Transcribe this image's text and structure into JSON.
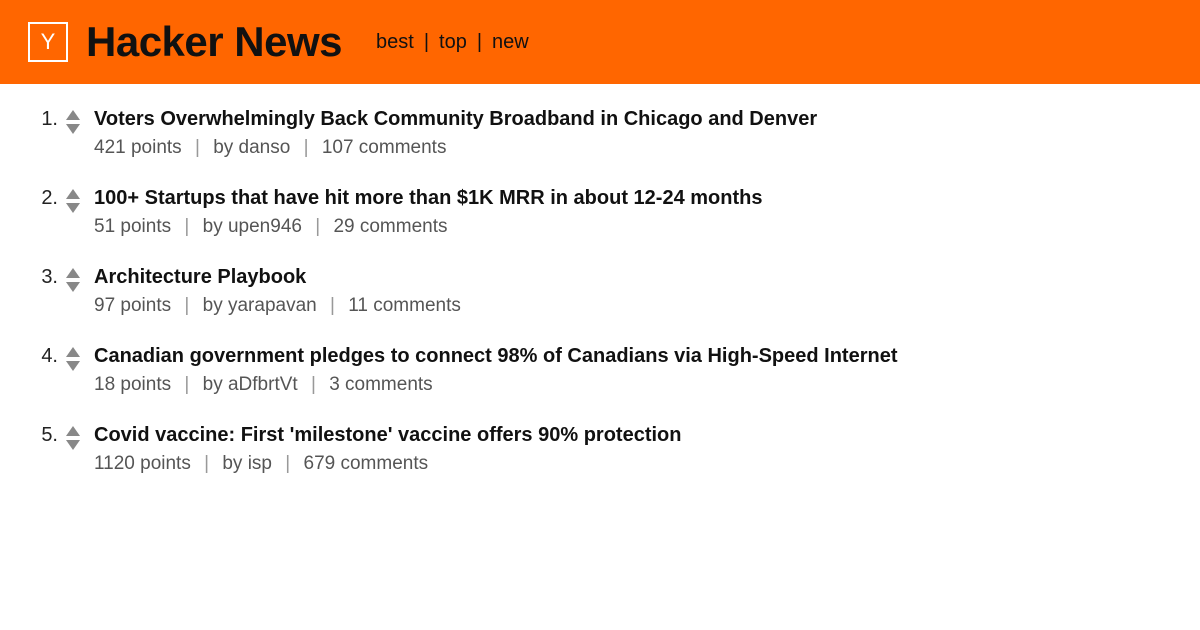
{
  "header": {
    "logo_letter": "Y",
    "title": "Hacker News",
    "nav": [
      "best",
      "top",
      "new"
    ]
  },
  "stories": [
    {
      "rank": "1.",
      "title": "Voters Overwhelmingly Back Community Broadband in Chicago and Denver",
      "points": "421 points",
      "by_prefix": "by ",
      "author": "danso",
      "comments": "107 comments"
    },
    {
      "rank": "2.",
      "title": "100+ Startups that have hit more than $1K MRR in about 12-24 months",
      "points": "51 points",
      "by_prefix": "by ",
      "author": "upen946",
      "comments": "29 comments"
    },
    {
      "rank": "3.",
      "title": "Architecture Playbook",
      "points": "97 points",
      "by_prefix": "by ",
      "author": "yarapavan",
      "comments": "11 comments"
    },
    {
      "rank": "4.",
      "title": "Canadian government pledges to connect 98% of Canadians via High-Speed Internet",
      "points": "18 points",
      "by_prefix": "by ",
      "author": "aDfbrtVt",
      "comments": "3 comments"
    },
    {
      "rank": "5.",
      "title": "Covid vaccine: First 'milestone' vaccine offers 90% protection",
      "points": "1120 points",
      "by_prefix": "by ",
      "author": "isp",
      "comments": "679 comments"
    }
  ],
  "sep": "|"
}
